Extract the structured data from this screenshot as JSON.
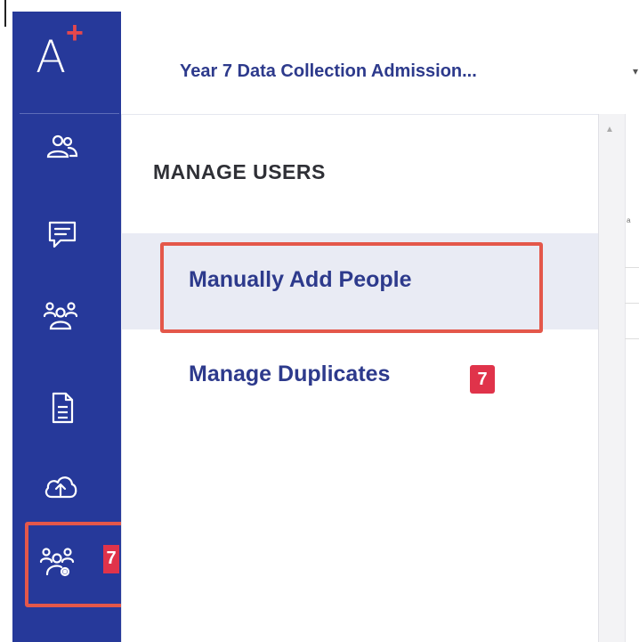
{
  "app": {
    "logo_letter": "A",
    "logo_plus": "+",
    "dataset_title": "Year 7 Data Collection Admission...",
    "dropdown_icon": "chevron-down-icon"
  },
  "sidebar": {
    "items": [
      {
        "icon": "users-icon"
      },
      {
        "icon": "chat-icon"
      },
      {
        "icon": "groups-icon"
      },
      {
        "icon": "document-icon"
      },
      {
        "icon": "cloud-upload-icon"
      },
      {
        "icon": "manage-users-icon",
        "badge": "7",
        "highlighted": true
      }
    ]
  },
  "panel": {
    "section_title": "MANAGE USERS",
    "menu": [
      {
        "label": "Manually Add People",
        "active": true,
        "highlighted": true
      },
      {
        "label": "Manage Duplicates",
        "badge": "7"
      }
    ]
  },
  "colors": {
    "rail": "#26399a",
    "accent_text": "#2d3a8c",
    "badge": "#e0334a",
    "highlight": "#e4574a",
    "active_row": "#e9ebf4"
  }
}
